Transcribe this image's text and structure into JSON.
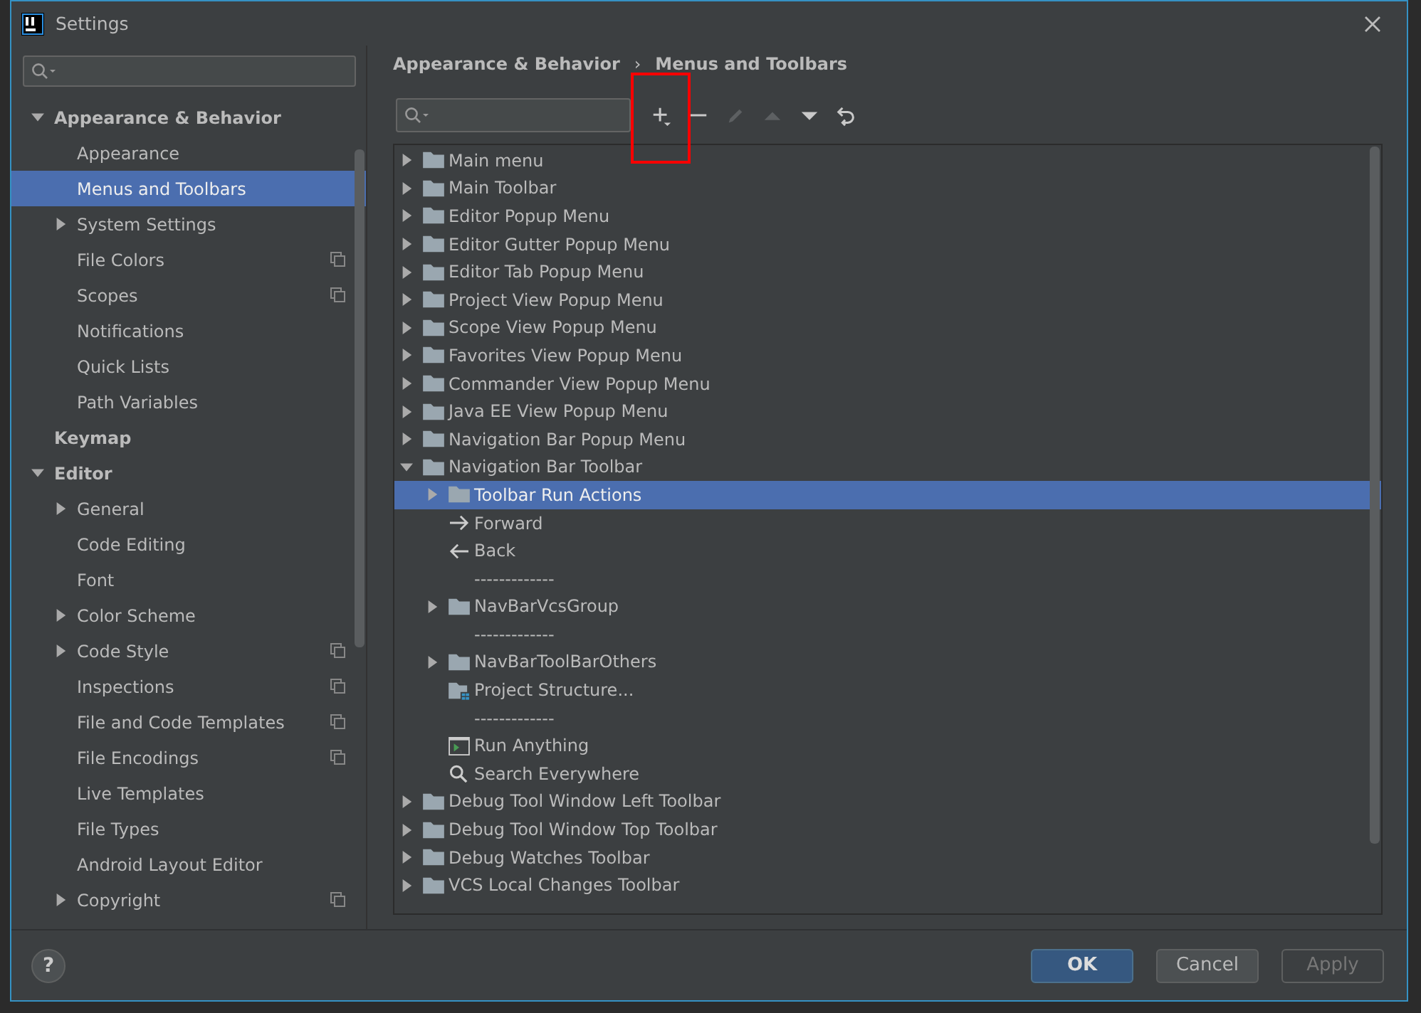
{
  "window": {
    "title": "Settings"
  },
  "sidebar": {
    "items": [
      {
        "label": "Appearance & Behavior",
        "expanded": true,
        "selected": false,
        "children": [
          {
            "label": "Appearance",
            "selected": false,
            "project_badge": false
          },
          {
            "label": "Menus and Toolbars",
            "selected": true,
            "project_badge": false
          },
          {
            "label": "System Settings",
            "expanded": false,
            "selected": false,
            "project_badge": false
          },
          {
            "label": "File Colors",
            "selected": false,
            "project_badge": true
          },
          {
            "label": "Scopes",
            "selected": false,
            "project_badge": true
          },
          {
            "label": "Notifications",
            "selected": false,
            "project_badge": false
          },
          {
            "label": "Quick Lists",
            "selected": false,
            "project_badge": false
          },
          {
            "label": "Path Variables",
            "selected": false,
            "project_badge": false
          }
        ]
      },
      {
        "label": "Keymap",
        "selected": false
      },
      {
        "label": "Editor",
        "expanded": true,
        "selected": false,
        "children": [
          {
            "label": "General",
            "expanded": false,
            "selected": false,
            "project_badge": false
          },
          {
            "label": "Code Editing",
            "selected": false,
            "project_badge": false
          },
          {
            "label": "Font",
            "selected": false,
            "project_badge": false
          },
          {
            "label": "Color Scheme",
            "expanded": false,
            "selected": false,
            "project_badge": false
          },
          {
            "label": "Code Style",
            "expanded": false,
            "selected": false,
            "project_badge": true
          },
          {
            "label": "Inspections",
            "selected": false,
            "project_badge": true
          },
          {
            "label": "File and Code Templates",
            "selected": false,
            "project_badge": true
          },
          {
            "label": "File Encodings",
            "selected": false,
            "project_badge": true
          },
          {
            "label": "Live Templates",
            "selected": false,
            "project_badge": false
          },
          {
            "label": "File Types",
            "selected": false,
            "project_badge": false
          },
          {
            "label": "Android Layout Editor",
            "selected": false,
            "project_badge": false
          },
          {
            "label": "Copyright",
            "expanded": false,
            "selected": false,
            "project_badge": true
          }
        ]
      }
    ]
  },
  "breadcrumb": [
    "Appearance & Behavior",
    "Menus and Toolbars"
  ],
  "breadcrumb_separator": "›",
  "toolbar": {
    "buttons": [
      {
        "kind": "add",
        "disabled": false,
        "highlighted": true
      },
      {
        "kind": "remove",
        "disabled": false,
        "highlighted": false
      },
      {
        "kind": "edit",
        "disabled": true,
        "highlighted": false
      },
      {
        "kind": "up",
        "disabled": true,
        "highlighted": false
      },
      {
        "kind": "down",
        "disabled": false,
        "highlighted": false
      },
      {
        "kind": "restore",
        "disabled": false,
        "highlighted": false
      }
    ]
  },
  "tree": [
    {
      "kind": "group",
      "label": "Main menu",
      "expanded": false,
      "selected": false
    },
    {
      "kind": "group",
      "label": "Main Toolbar",
      "expanded": false,
      "selected": false
    },
    {
      "kind": "group",
      "label": "Editor Popup Menu",
      "expanded": false,
      "selected": false
    },
    {
      "kind": "group",
      "label": "Editor Gutter Popup Menu",
      "expanded": false,
      "selected": false
    },
    {
      "kind": "group",
      "label": "Editor Tab Popup Menu",
      "expanded": false,
      "selected": false
    },
    {
      "kind": "group",
      "label": "Project View Popup Menu",
      "expanded": false,
      "selected": false
    },
    {
      "kind": "group",
      "label": "Scope View Popup Menu",
      "expanded": false,
      "selected": false
    },
    {
      "kind": "group",
      "label": "Favorites View Popup Menu",
      "expanded": false,
      "selected": false
    },
    {
      "kind": "group",
      "label": "Commander View Popup Menu",
      "expanded": false,
      "selected": false
    },
    {
      "kind": "group",
      "label": "Java EE View Popup Menu",
      "expanded": false,
      "selected": false
    },
    {
      "kind": "group",
      "label": "Navigation Bar Popup Menu",
      "expanded": false,
      "selected": false
    },
    {
      "kind": "group",
      "label": "Navigation Bar Toolbar",
      "expanded": true,
      "selected": false,
      "children": [
        {
          "kind": "group",
          "label": "Toolbar Run Actions",
          "expanded": false,
          "selected": true
        },
        {
          "kind": "forward",
          "label": "Forward",
          "selected": false
        },
        {
          "kind": "back",
          "label": "Back",
          "selected": false
        },
        {
          "kind": "separator",
          "label": "-------------",
          "selected": false
        },
        {
          "kind": "group",
          "label": "NavBarVcsGroup",
          "expanded": false,
          "selected": false
        },
        {
          "kind": "separator",
          "label": "-------------",
          "selected": false
        },
        {
          "kind": "group",
          "label": "NavBarToolBarOthers",
          "expanded": false,
          "selected": false
        },
        {
          "kind": "structure",
          "label": "Project Structure...",
          "selected": false
        },
        {
          "kind": "separator",
          "label": "-------------",
          "selected": false
        },
        {
          "kind": "run",
          "label": "Run Anything",
          "selected": false
        },
        {
          "kind": "search",
          "label": "Search Everywhere",
          "selected": false
        }
      ]
    },
    {
      "kind": "group",
      "label": "Debug Tool Window Left Toolbar",
      "expanded": false,
      "selected": false
    },
    {
      "kind": "group",
      "label": "Debug Tool Window Top Toolbar",
      "expanded": false,
      "selected": false
    },
    {
      "kind": "group",
      "label": "Debug Watches Toolbar",
      "expanded": false,
      "selected": false
    },
    {
      "kind": "group",
      "label": "VCS Local Changes Toolbar",
      "expanded": false,
      "selected": false
    }
  ],
  "help": "?",
  "buttons": [
    {
      "label": "OK",
      "kind": "primary",
      "disabled": false
    },
    {
      "label": "Cancel",
      "kind": "normal",
      "disabled": false
    },
    {
      "label": "Apply",
      "kind": "normal",
      "disabled": true
    }
  ]
}
